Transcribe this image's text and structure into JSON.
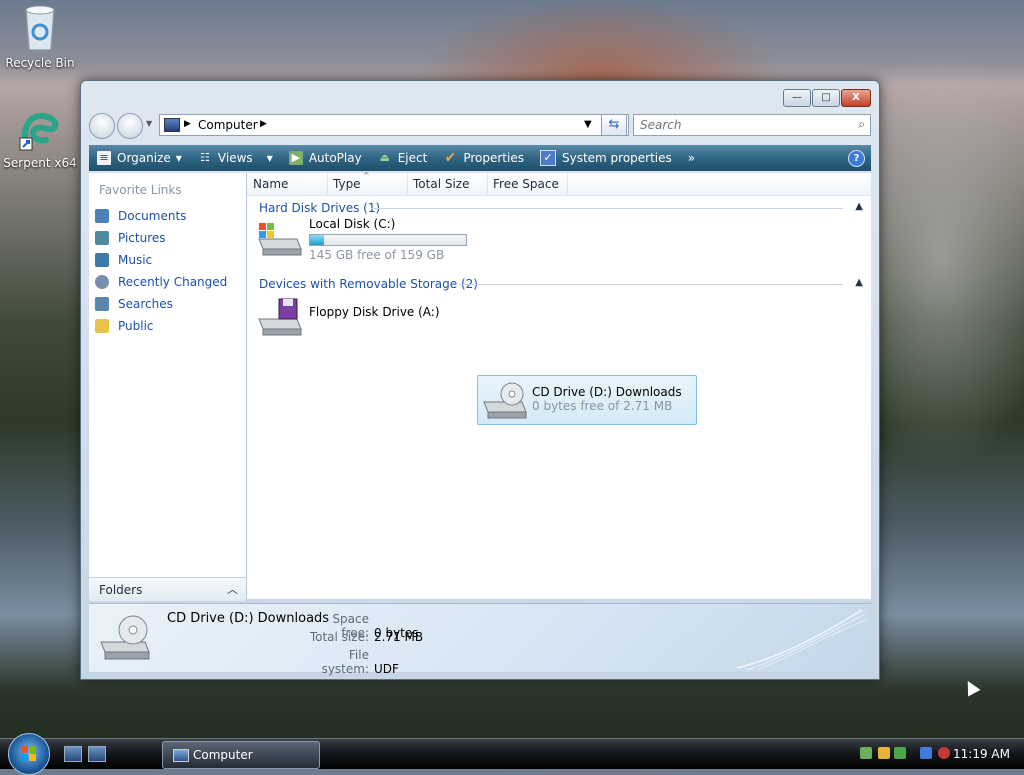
{
  "desktop": {
    "icons": [
      {
        "label": "Recycle Bin",
        "icon": "recycle-bin-icon"
      },
      {
        "label": "Serpent x64",
        "icon": "serpent-app-icon"
      }
    ]
  },
  "window": {
    "title": "Computer",
    "controls": {
      "minimize": "—",
      "maximize": "□",
      "close": "X"
    },
    "address": {
      "location": "Computer"
    },
    "search": {
      "placeholder": "Search"
    }
  },
  "toolbar": {
    "organize": "Organize",
    "views": "Views",
    "autoplay": "AutoPlay",
    "eject": "Eject",
    "properties": "Properties",
    "system_properties": "System properties",
    "more": "»",
    "help": "?"
  },
  "sidebar": {
    "title": "Favorite Links",
    "links": [
      {
        "label": "Documents",
        "color": "#4d7fb8"
      },
      {
        "label": "Pictures",
        "color": "#4f8b9e"
      },
      {
        "label": "Music",
        "color": "#3d7aa8"
      },
      {
        "label": "Recently Changed",
        "color": "#7a8fb0"
      },
      {
        "label": "Searches",
        "color": "#5c86a8"
      },
      {
        "label": "Public",
        "color": "#e8c24a"
      }
    ],
    "folders_label": "Folders"
  },
  "columns": [
    "Name",
    "Type",
    "Total Size",
    "Free Space"
  ],
  "groups": {
    "hard_disk": {
      "label": "Hard Disk Drives (1)"
    },
    "removable": {
      "label": "Devices with Removable Storage (2)"
    }
  },
  "drives": {
    "local": {
      "name": "Local Disk (C:)",
      "free_text": "145 GB free of 159 GB",
      "used_fraction": 0.088
    },
    "floppy": {
      "name": "Floppy Disk Drive (A:)"
    },
    "cd": {
      "name": "CD Drive (D:) Downloads",
      "free_text": "0 bytes free of 2.71 MB"
    }
  },
  "details": {
    "title": "CD Drive (D:) Downloads",
    "space_free_label": "Space free:",
    "space_free": "0 bytes",
    "total_size_label": "Total size:",
    "total_size": "2.71 MB",
    "file_system_label": "File system:",
    "file_system": "UDF"
  },
  "taskbar": {
    "window_button": "Computer",
    "clock": "11:19 AM"
  },
  "colors": {
    "toolbar": "#2f6584",
    "link": "#1f4fa8",
    "selection": "#d5eaf8",
    "drive_bar": "#1e9fd0"
  }
}
